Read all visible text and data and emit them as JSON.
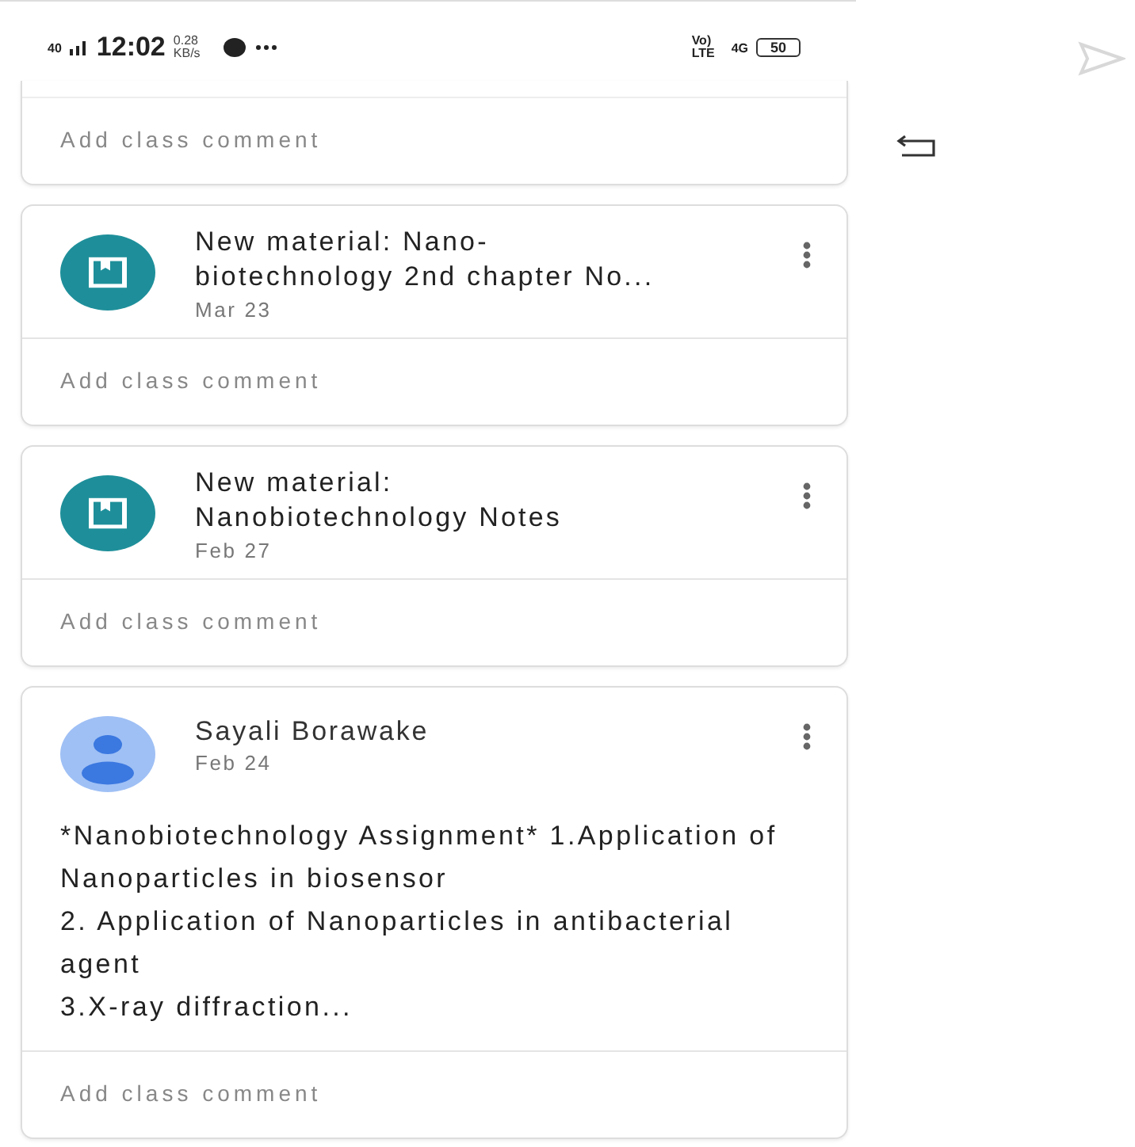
{
  "status_bar": {
    "network": "40",
    "time": "12:02",
    "speed": "0.28 KB/s",
    "carrier": "Vo) LTE",
    "network_right": "4G",
    "battery": "50"
  },
  "cards": [
    {
      "kind": "partial",
      "comment_placeholder": "Add class comment"
    },
    {
      "kind": "material",
      "title": "New material: Nano-\nbiotechnology 2nd chapter No...",
      "date": "Mar 23",
      "comment_placeholder": "Add class comment"
    },
    {
      "kind": "material",
      "title": "New material:\nNanobiotechnology Notes",
      "date": "Feb 27",
      "comment_placeholder": "Add class comment"
    },
    {
      "kind": "announcement",
      "author": "Sayali Borawake",
      "date": "Feb 24",
      "body": "*Nanobiotechnology Assignment* 1.Application of Nanoparticles in biosensor\n2. Application of Nanoparticles in antibacterial agent\n3.X-ray diffraction...",
      "comment_placeholder": "Add class comment"
    }
  ]
}
